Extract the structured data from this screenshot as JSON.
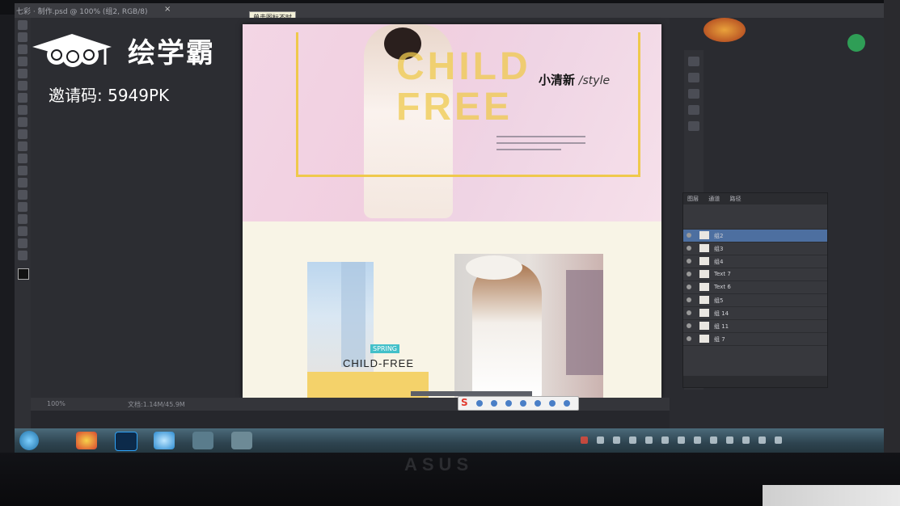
{
  "photoshop": {
    "tab_title": "七彩 · 制作.psd @ 100% (组2, RGB/8)",
    "tab_close": "×",
    "tooltip": "单击图标不时",
    "status_zoom": "100%",
    "status_doc": "文档:1.14M/45.9M"
  },
  "canvas": {
    "headline_line1": "CHILD",
    "headline_line2": "FREE",
    "subtitle_cn": "小清新",
    "subtitle_en": "/style",
    "badge": "SPRING",
    "photo_caption": "CHILD-FREE"
  },
  "ime": {
    "logo_letter": "S"
  },
  "layers_panel": {
    "tabs": [
      "图层",
      "通道",
      "路径"
    ],
    "rows": [
      "组2",
      "组3",
      "组4",
      "Text 7",
      "Text 6",
      "组5",
      "组 14",
      "组 11",
      "组 7"
    ]
  },
  "device": {
    "brand": "ASUS"
  },
  "watermark": {
    "brand": "绘学霸",
    "invite_code": "邀请码: 5949PK"
  },
  "colors": {
    "accent_yellow": "#efc94c",
    "banner_pink": "#f3d6e5",
    "taskbar": "#2e4450"
  }
}
